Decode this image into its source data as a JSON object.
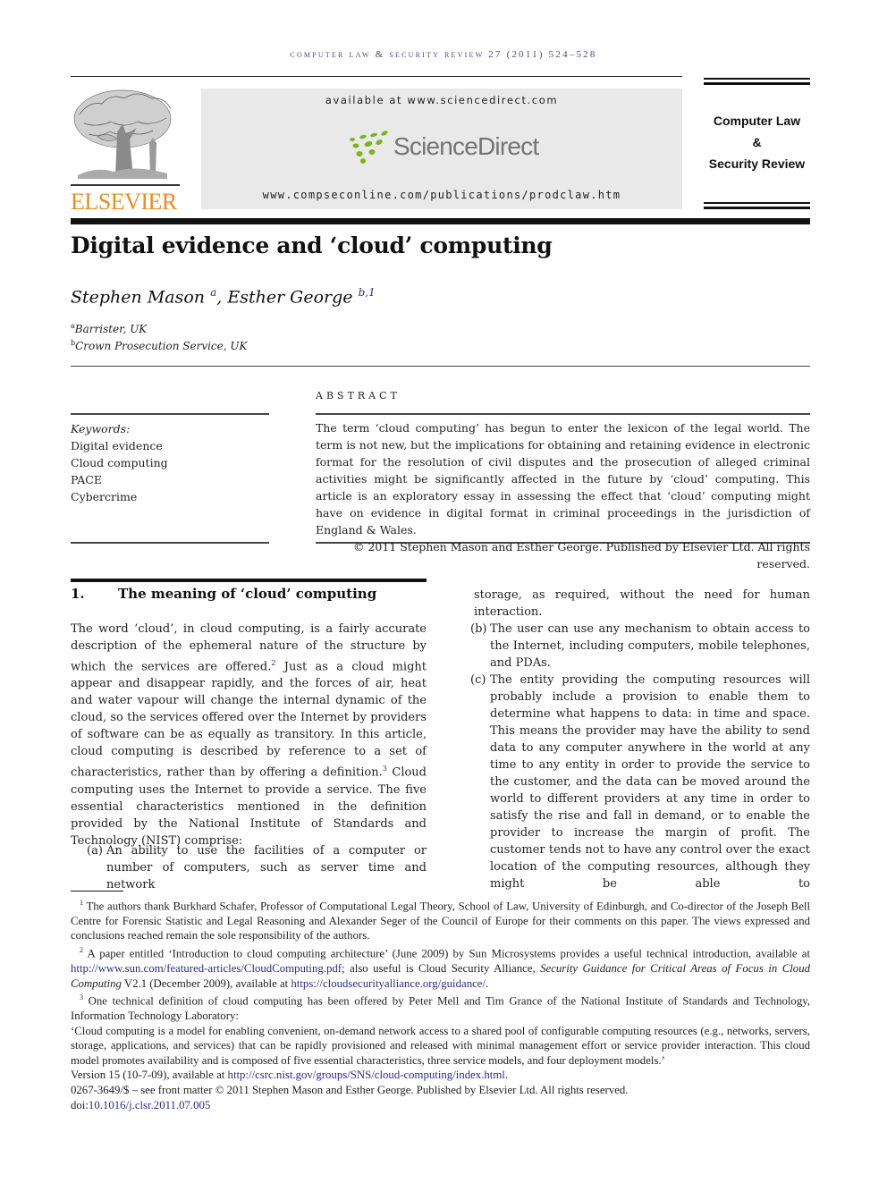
{
  "running_header": "computer law & security review 27 (2011) 524–528",
  "publisher": {
    "name": "ELSEVIER",
    "brand_color": "#f08a1c"
  },
  "sciencedirect": {
    "available_text": "available at www.sciencedirect.com",
    "logo_text": "ScienceDirect",
    "logo_color": "#7ab51d",
    "journal_url": "www.compseconline.com/publications/prodclaw.htm"
  },
  "journal": {
    "line1": "Computer Law",
    "line2": "&",
    "line3": "Security Review"
  },
  "article": {
    "title": "Digital evidence and ‘cloud’ computing",
    "authors": [
      {
        "name": "Stephen Mason",
        "sup": "a"
      },
      {
        "name": "Esther George",
        "sup": "b,1"
      }
    ],
    "affiliations": [
      {
        "mark": "a",
        "text": "Barrister, UK"
      },
      {
        "mark": "b",
        "text": "Crown Prosecution Service, UK"
      }
    ]
  },
  "keywords": {
    "label": "Keywords:",
    "items": [
      "Digital evidence",
      "Cloud computing",
      "PACE",
      "Cybercrime"
    ]
  },
  "abstract": {
    "heading": "ABSTRACT",
    "text": "The term ‘cloud computing’ has begun to enter the lexicon of the legal world. The term is not new, but the implications for obtaining and retaining evidence in electronic format for the resolution of civil disputes and the prosecution of alleged criminal activities might be significantly affected in the future by ‘cloud’ computing. This article is an exploratory essay in assessing the effect that ‘cloud’ computing might have on evidence in digital format in criminal proceedings in the jurisdiction of England & Wales.",
    "copyright": "© 2011 Stephen Mason and Esther George. Published by Elsevier Ltd. All rights reserved."
  },
  "section1": {
    "number": "1.",
    "title": "The meaning of ‘cloud’ computing",
    "para_part1": "The word ‘cloud’, in cloud computing, is a fairly accurate description of the ephemeral nature of the structure by which the services are offered.",
    "fn2": "2",
    "para_part2": " Just as a cloud might appear and disappear rapidly, and the forces of air, heat and water vapour will change the internal dynamic of the cloud, so the services offered over the Internet by providers of software can be as equally as transitory. In this article, cloud computing is described by reference to a set of characteristics, rather than by offering a definition.",
    "fn3": "3",
    "para_part3": " Cloud computing uses the Internet to provide a service. The five essential characteristics mentioned in the definition provided by the National Institute of Standards and Technology (NIST) comprise:",
    "list": [
      {
        "label": "(a)",
        "text_col1": "An ability to use the facilities of a computer or number of computers, such as server time and network",
        "text_col2": "storage, as required, without the need for human interaction."
      },
      {
        "label": "(b)",
        "text": "The user can use any mechanism to obtain access to the Internet, including computers, mobile telephones, and PDAs."
      },
      {
        "label": "(c)",
        "text": "The entity providing the computing resources will probably include a provision to enable them to determine what happens to data: in time and space. This means the provider may have the ability to send data to any computer anywhere in the world at any time to any entity in order to provide the service to the customer, and the data can be moved around the world to different providers at any time in order to satisfy the rise and fall in demand, or to enable the provider to increase the margin of profit. The customer tends not to have any control over the exact location of the computing resources, although they might be able to"
      }
    ]
  },
  "footnotes": {
    "fn1": {
      "mark": "1",
      "text": "The authors thank Burkhard Schafer, Professor of Computational Legal Theory, School of Law, University of Edinburgh, and Co-director of the Joseph Bell Centre for Forensic Statistic and Legal Reasoning and Alexander Seger of the Council of Europe for their comments on this paper. The views expressed and conclusions reached remain the sole responsibility of the authors."
    },
    "fn2": {
      "mark": "2",
      "text1": "A paper entitled ‘Introduction to cloud computing architecture’ (June 2009) by Sun Microsystems provides a useful technical introduction, available at ",
      "link1": "http://www.sun.com/featured-articles/CloudComputing.pdf",
      "text2": "; also useful is Cloud Security Alliance, ",
      "italic": "Security Guidance for Critical Areas of Focus in Cloud Computing",
      "text3": " V2.1 (December 2009), available at ",
      "link2": "https://cloudsecurityalliance.org/guidance/",
      "text4": "."
    },
    "fn3": {
      "mark": "3",
      "text1": "One technical definition of cloud computing has been offered by Peter Mell and Tim Grance of the National Institute of Standards and Technology, Information Technology Laboratory:",
      "quote": "‘Cloud computing is a model for enabling convenient, on-demand network access to a shared pool of configurable computing resources (e.g., networks, servers, storage, applications, and services) that can be rapidly provisioned and released with minimal management effort or service provider interaction. This cloud model promotes availability and is composed of five essential characteristics, three service models, and four deployment models.’",
      "version_text": "Version 15 (10-7-09), available at ",
      "link": "http://csrc.nist.gov/groups/SNS/cloud-computing/index.html",
      "end": "."
    },
    "front_matter": "0267-3649/$ – see front matter © 2011 Stephen Mason and Esther George. Published by Elsevier Ltd. All rights reserved.",
    "doi_label": "doi:",
    "doi": "10.1016/j.clsr.2011.07.005"
  }
}
